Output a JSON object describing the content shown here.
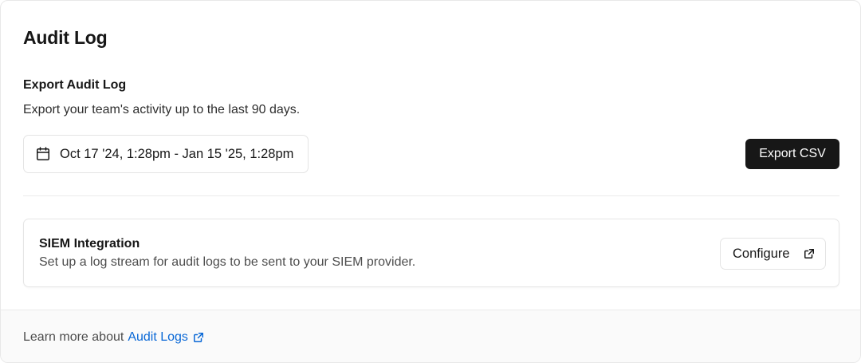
{
  "header": {
    "title": "Audit Log"
  },
  "export": {
    "title": "Export Audit Log",
    "description": "Export your team's activity up to the last 90 days.",
    "date_range": "Oct 17 '24, 1:28pm - Jan 15 '25, 1:28pm",
    "date_icon": "calendar-icon",
    "button_label": "Export CSV"
  },
  "siem": {
    "title": "SIEM Integration",
    "description": "Set up a log stream for audit logs to be sent to your SIEM provider.",
    "button_label": "Configure",
    "button_icon": "external-link-icon"
  },
  "footer": {
    "prefix": "Learn more about",
    "link_label": "Audit Logs",
    "link_icon": "external-link-icon"
  },
  "colors": {
    "primary_button": "#171717",
    "link": "#0a68d6",
    "footer_bg": "#fafafa"
  }
}
